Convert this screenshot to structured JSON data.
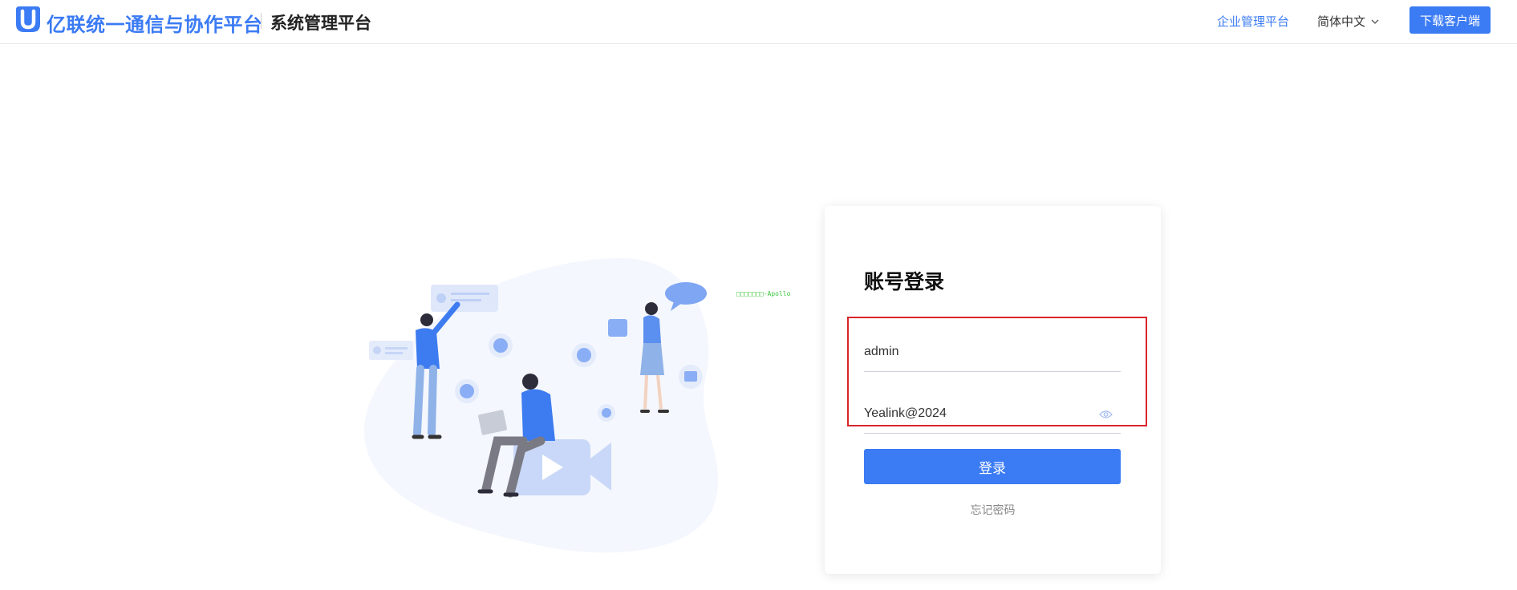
{
  "header": {
    "brand": "亿联统一通信与协作平台",
    "system_title": "系统管理平台",
    "enterprise_link": "企业管理平台",
    "language": "简体中文",
    "download_button": "下载客户端"
  },
  "illustration": {
    "caption": "□□□□□□□-Apollo"
  },
  "login": {
    "title": "账号登录",
    "username_value": "admin",
    "password_value": "Yealink@2024",
    "login_button": "登录",
    "forgot_password": "忘记密码"
  },
  "colors": {
    "accent": "#3b7bf4",
    "highlight_border": "#d8262b"
  }
}
